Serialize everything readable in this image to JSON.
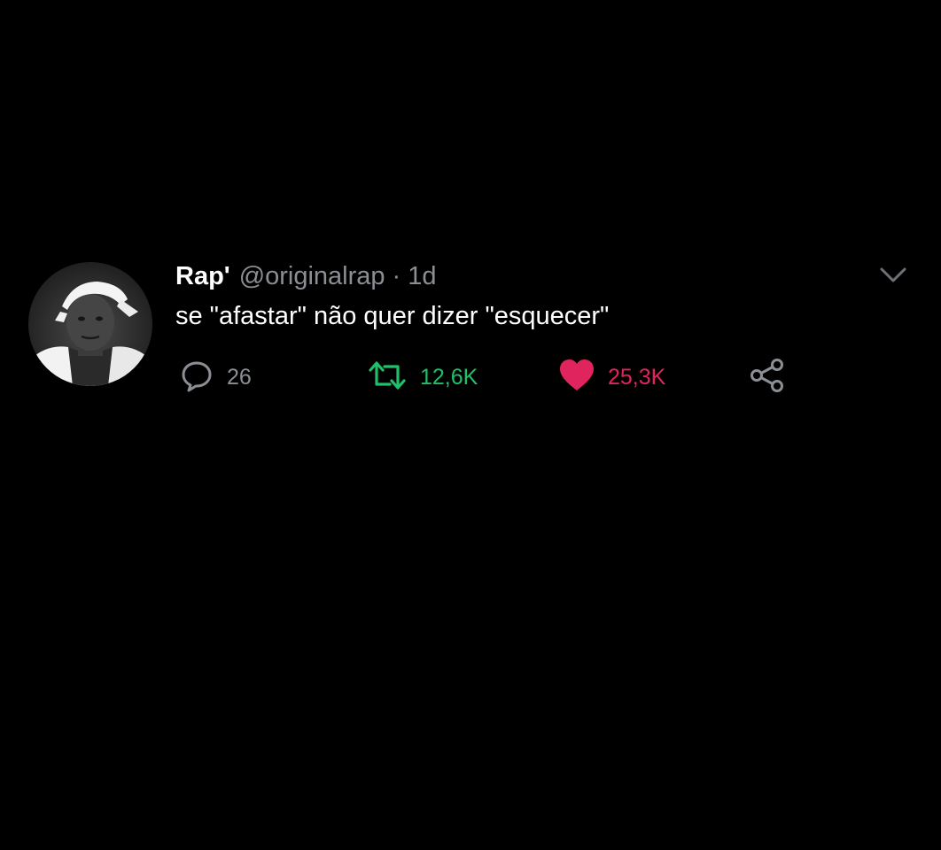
{
  "tweet": {
    "display_name": "Rap'",
    "handle": "@originalrap",
    "separator": "·",
    "time": "1d",
    "text": "se \"afastar\" não quer dizer \"esquecer\"",
    "avatar_icon": "profile-photo",
    "menu_icon": "chevron-down-icon"
  },
  "actions": {
    "reply": {
      "icon": "reply-icon",
      "count": "26"
    },
    "retweet": {
      "icon": "retweet-icon",
      "count": "12,6K"
    },
    "like": {
      "icon": "heart-icon",
      "count": "25,3K"
    },
    "share": {
      "icon": "share-icon"
    }
  },
  "colors": {
    "background": "#000000",
    "text": "#ffffff",
    "muted": "#8b8f94",
    "retweet_active": "#1fbf6b",
    "like_active": "#e0245e"
  }
}
